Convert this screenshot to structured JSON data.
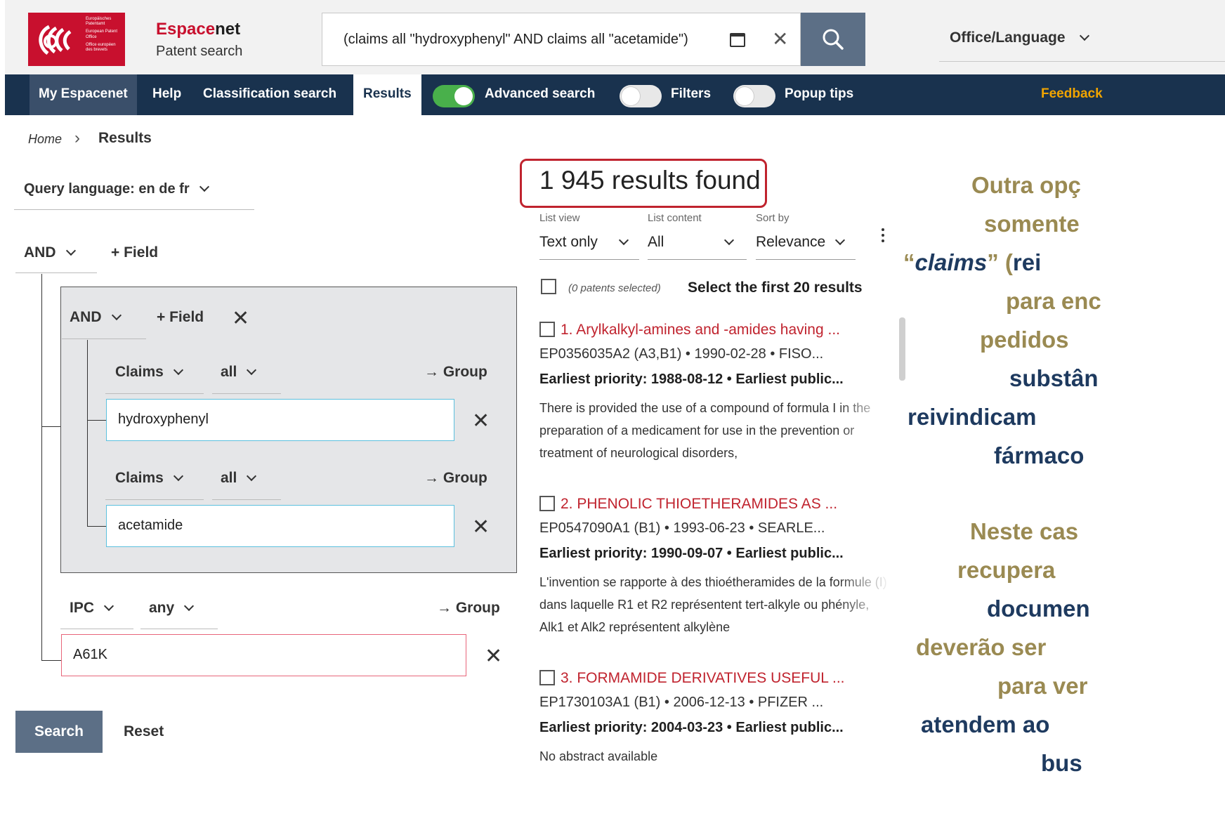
{
  "header": {
    "logo_lines": [
      "Europäisches Patentamt",
      "European Patent Office",
      "Office européen des brevets"
    ],
    "brand_prefix": "Espace",
    "brand_suffix": "net",
    "brand_sub": "Patent search",
    "search_query": "(claims all \"hydroxyphenyl\" AND claims all \"acetamide\")",
    "office_language": "Office/Language"
  },
  "nav": {
    "my_espacenet": "My Espacenet",
    "help": "Help",
    "classification": "Classification search",
    "results": "Results",
    "advanced_search": "Advanced search",
    "filters": "Filters",
    "popup_tips": "Popup tips",
    "feedback": "Feedback"
  },
  "toggles": {
    "advanced_search": true,
    "filters": false,
    "popup_tips": false
  },
  "breadcrumb": {
    "home": "Home",
    "current": "Results"
  },
  "query_builder": {
    "query_language": "Query language: en de fr",
    "root_operator": "AND",
    "add_field": "+ Field",
    "group": {
      "operator": "AND",
      "add_field": "+ Field",
      "rows": [
        {
          "field": "Claims",
          "mode": "all",
          "group_label": "→ Group",
          "value": "hydroxyphenyl"
        },
        {
          "field": "Claims",
          "mode": "all",
          "group_label": "→ Group",
          "value": "acetamide"
        }
      ]
    },
    "ipc_row": {
      "field": "IPC",
      "mode": "any",
      "group_label": "→ Group",
      "value": "A61K"
    },
    "search_button": "Search",
    "reset_button": "Reset"
  },
  "results": {
    "count_text": "1 945 results found",
    "list_view_label": "List view",
    "list_view_value": "Text only",
    "list_content_label": "List content",
    "list_content_value": "All",
    "sort_label": "Sort by",
    "sort_value": "Relevance",
    "selected_note": "(0 patents selected)",
    "select_first": "Select the first 20 results",
    "items": [
      {
        "title": "1. Arylkalkyl-amines and -amides having ...",
        "meta": "EP0356035A2 (A3,B1) • 1990-02-28 • FISO...",
        "priority": "Earliest priority: 1988-08-12 • Earliest public...",
        "abstract": "There is provided the use of a compound of formula I in the preparation of a medicament for use in the prevention or treatment of neurological disorders,"
      },
      {
        "title": "2. PHENOLIC THIOETHERAMIDES AS ...",
        "meta": "EP0547090A1 (B1) • 1993-06-23 • SEARLE...",
        "priority": "Earliest priority: 1990-09-07 • Earliest public...",
        "abstract": "L'invention se rapporte à des thioétheramides de la formule (I) dans laquelle R1 et R2 représentent tert-alkyle ou phényle, Alk1 et Alk2 représentent alkylène"
      },
      {
        "title": "3. FORMAMIDE DERIVATIVES USEFUL ...",
        "meta": "EP1730103A1 (B1) • 2006-12-13 • PFIZER ...",
        "priority": "Earliest priority: 2004-03-23 • Earliest public...",
        "abstract": "No abstract available"
      }
    ]
  },
  "annotation": {
    "p1": [
      "Outra opç",
      "somente",
      "“claims” (rei",
      "para enc",
      "pedidos",
      "substân",
      "reivindicam",
      "fármaco"
    ],
    "p2": [
      "Neste cas",
      "recupera",
      "documen",
      "deverão ser",
      "para ver",
      "atendem ao",
      "bus"
    ],
    "colors": {
      "gold": "#9a8a52",
      "navy": "#1e3a5f"
    }
  }
}
